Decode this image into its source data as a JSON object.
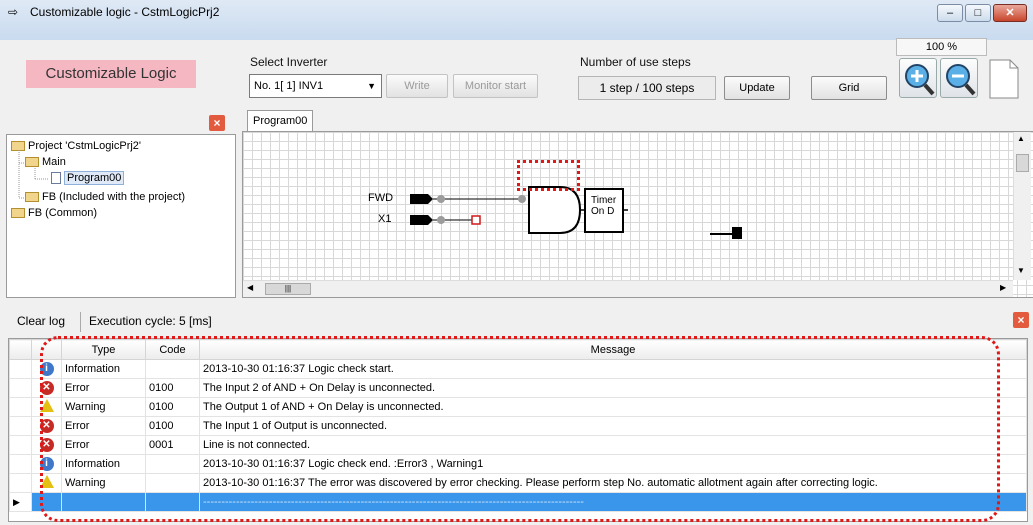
{
  "window": {
    "title": "Customizable logic - CstmLogicPrj2",
    "controls": {
      "minimize": "–",
      "maximize": "□",
      "close": "✕"
    }
  },
  "toolbar": {
    "app_label": "Customizable Logic",
    "select_inverter_label": "Select Inverter",
    "inverter_value": "No. 1[ 1] INV1",
    "write_label": "Write",
    "monitor_label": "Monitor start",
    "steps_label": "Number of use steps",
    "steps_value": "1 step / 100 steps",
    "update_label": "Update",
    "grid_label": "Grid",
    "zoom": "100 %"
  },
  "tree": {
    "items": [
      "Project 'CstmLogicPrj2'",
      "Main",
      "Program00",
      "FB (Included with the project)",
      "FB (Common)"
    ]
  },
  "editor": {
    "tab": "Program00",
    "inputs": [
      "FWD",
      "X1"
    ],
    "block_label_1": "Timer",
    "block_label_2": "On D"
  },
  "log": {
    "clear_label": "Clear log",
    "cycle_label": "Execution cycle:  5  [ms]",
    "columns": [
      "Type",
      "Code",
      "Message"
    ],
    "rows": [
      {
        "icon": "info-icon",
        "type": "Information",
        "code": "",
        "message": "2013-10-30 01:16:37 Logic check start."
      },
      {
        "icon": "error-icon",
        "type": "Error",
        "code": "0100",
        "message": "The Input 2 of AND + On Delay  is unconnected."
      },
      {
        "icon": "warning-icon",
        "type": "Warning",
        "code": "0100",
        "message": "The Output 1 of AND + On Delay  is unconnected."
      },
      {
        "icon": "error-icon",
        "type": "Error",
        "code": "0100",
        "message": "The Input 1 of Output  is unconnected."
      },
      {
        "icon": "error-icon",
        "type": "Error",
        "code": "0001",
        "message": "Line is not connected."
      },
      {
        "icon": "info-icon",
        "type": "Information",
        "code": "",
        "message": "2013-10-30 01:16:37 Logic check end.  :Error3 , Warning1"
      },
      {
        "icon": "warning-icon",
        "type": "Warning",
        "code": "",
        "message": "2013-10-30 01:16:37 The error was discovered by error checking. Please perform step No. automatic allotment again after correcting logic."
      },
      {
        "icon": "",
        "type": "",
        "code": "",
        "message": "--------------------------------------------------------------------------------------------------------"
      }
    ]
  },
  "colors": {
    "accent": "#f5b8c3",
    "highlight": "#e01818",
    "selection": "#3a96ea"
  }
}
